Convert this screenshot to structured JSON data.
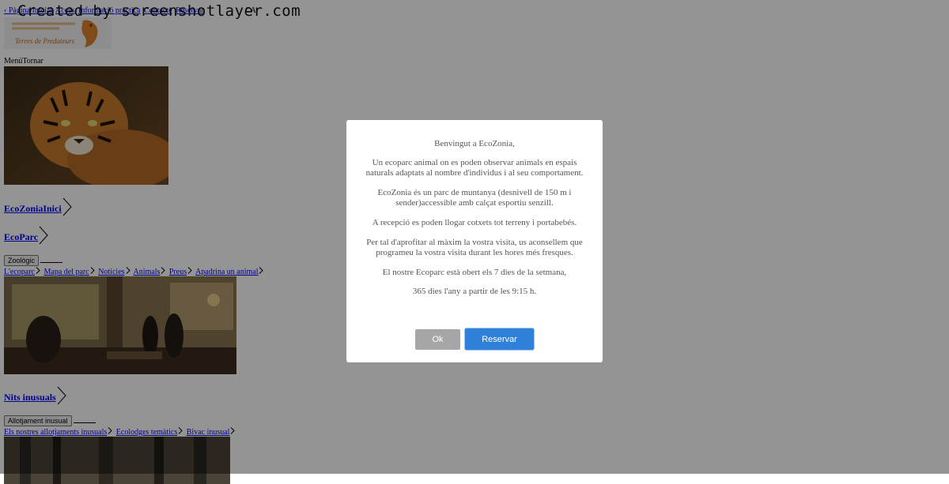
{
  "watermark": "Created by screenshotlayer.com",
  "topnav": {
    "links": [
      "‹ Pàgina Inicial",
      "Accés",
      "Informació pràctica",
      "Contacte",
      "Reservar"
    ],
    "lang": "CA"
  },
  "logo": {
    "subtitle": "Terres de Predateurs"
  },
  "menu_row": {
    "menu": "Menú",
    "back": "Tornar"
  },
  "sections": {
    "ecozonia_link": "EcoZoniaInici",
    "ecoparc_link": "EcoParc",
    "zoo_button": "Zoològic",
    "ecoparc_links": [
      "L'ecoparc",
      "Mapa del parc",
      "Notícies",
      "Animals",
      "Preus",
      "Apadrina un animal"
    ],
    "nits_link": "Nits inusuals",
    "allotjament_button": "Allotjament inusual",
    "nits_links": [
      "Els nostres allotjaments inusuals",
      "Ecolodges temàtics",
      "Bivac inusual"
    ]
  },
  "modal": {
    "heading": "Benvingut a EcoZonia,",
    "p1": "Un ecoparc animal on es poden observar animals en espais naturals adaptats al nombre d'individus i al seu comportament.",
    "p2": "EcoZonia és un parc de muntanya (desnivell de 150 m i sender)accessible amb calçat esportiu senzill.",
    "p3": "A recepció es poden llogar cotxets tot terreny i portabebés.",
    "p4": "Per tal d'aprofitar al màxim la vostra visita, us aconsellem que programeu la vostra visita durant les hores més fresques.",
    "p5": "El nostre Ecoparc està obert els 7 dies de la setmana,",
    "p6": "365 dies l'any a partir de les 9:15 h.",
    "ok_label": "Ok",
    "book_label": "Reservar"
  },
  "colors": {
    "overlay": "rgba(0,0,0,0.42)",
    "book_button": "#2f80d8",
    "ok_button": "#a6a6a6",
    "logo_orange": "#d9822b"
  }
}
